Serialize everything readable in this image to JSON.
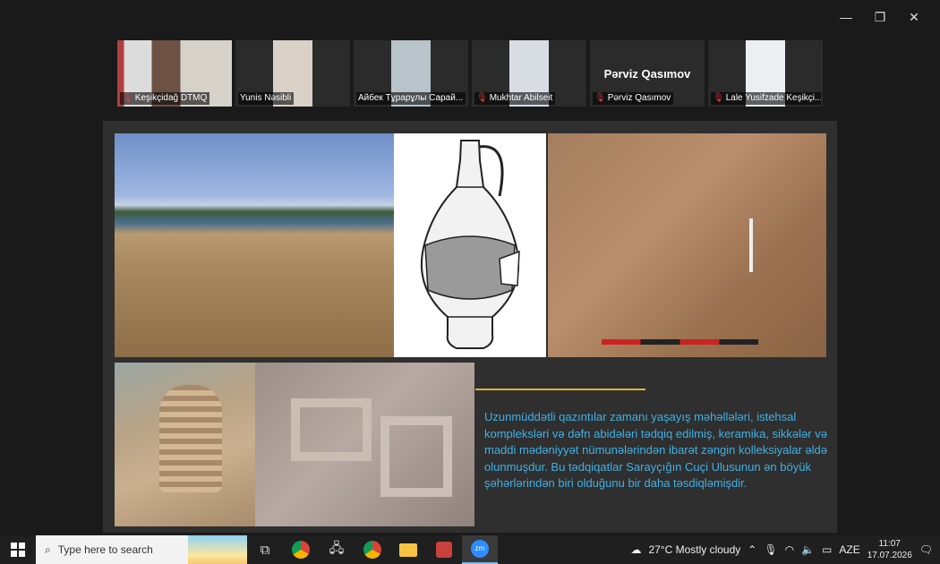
{
  "window": {
    "minimize": "—",
    "restore": "❐",
    "close": "✕"
  },
  "participants": [
    {
      "name": "Keşikçidağ DTMQ",
      "muted": true,
      "active": false,
      "bg": "#7a8a9a"
    },
    {
      "name": "Yunis Nəsibli",
      "muted": false,
      "active": false,
      "bg": "#cfc8c0"
    },
    {
      "name": "Айбек Тұрарұлы Сарай...",
      "muted": false,
      "active": true,
      "bg": "#b7c2c9"
    },
    {
      "name": "Mukhtar Abilseit",
      "muted": true,
      "active": false,
      "bg": "#d8dde3"
    },
    {
      "name": "Pərviz Qasımov",
      "muted": true,
      "active": false,
      "bg": "#2b2b2b",
      "display_name": "Pərviz Qasımov"
    },
    {
      "name": "Lale Yusifzade Keşikçi...",
      "muted": true,
      "active": false,
      "bg": "#e9eaee"
    }
  ],
  "slide": {
    "text": "Uzunmüddətli qazıntılar zamanı yaşayış məhəllələri, istehsal kompleksləri və dəfn abidələri tədqiq edilmiş, keramika, sikkələr və maddi mədəniyyət nümunələrindən ibarət zəngin kolleksiyalar əldə olunmuşdur. Bu tədqiqatlar Sarayçığın Cuçi Ulusunun ən böyük şəhərlərindən biri olduğunu bir daha təsdiqləmişdir.",
    "rule_color": "#e0b53a",
    "text_color": "#3fb1e6"
  },
  "taskbar": {
    "search_placeholder": "Type here to search",
    "weather": "27°C  Mostly cloudy",
    "language": "AZE",
    "time": "11:07",
    "date": "17.07.2026",
    "apps": [
      "task-view-icon",
      "chrome-icon",
      "network-app-icon",
      "chrome-profile-icon",
      "file-explorer-icon",
      "paint-app-icon",
      "zoom-icon"
    ]
  }
}
